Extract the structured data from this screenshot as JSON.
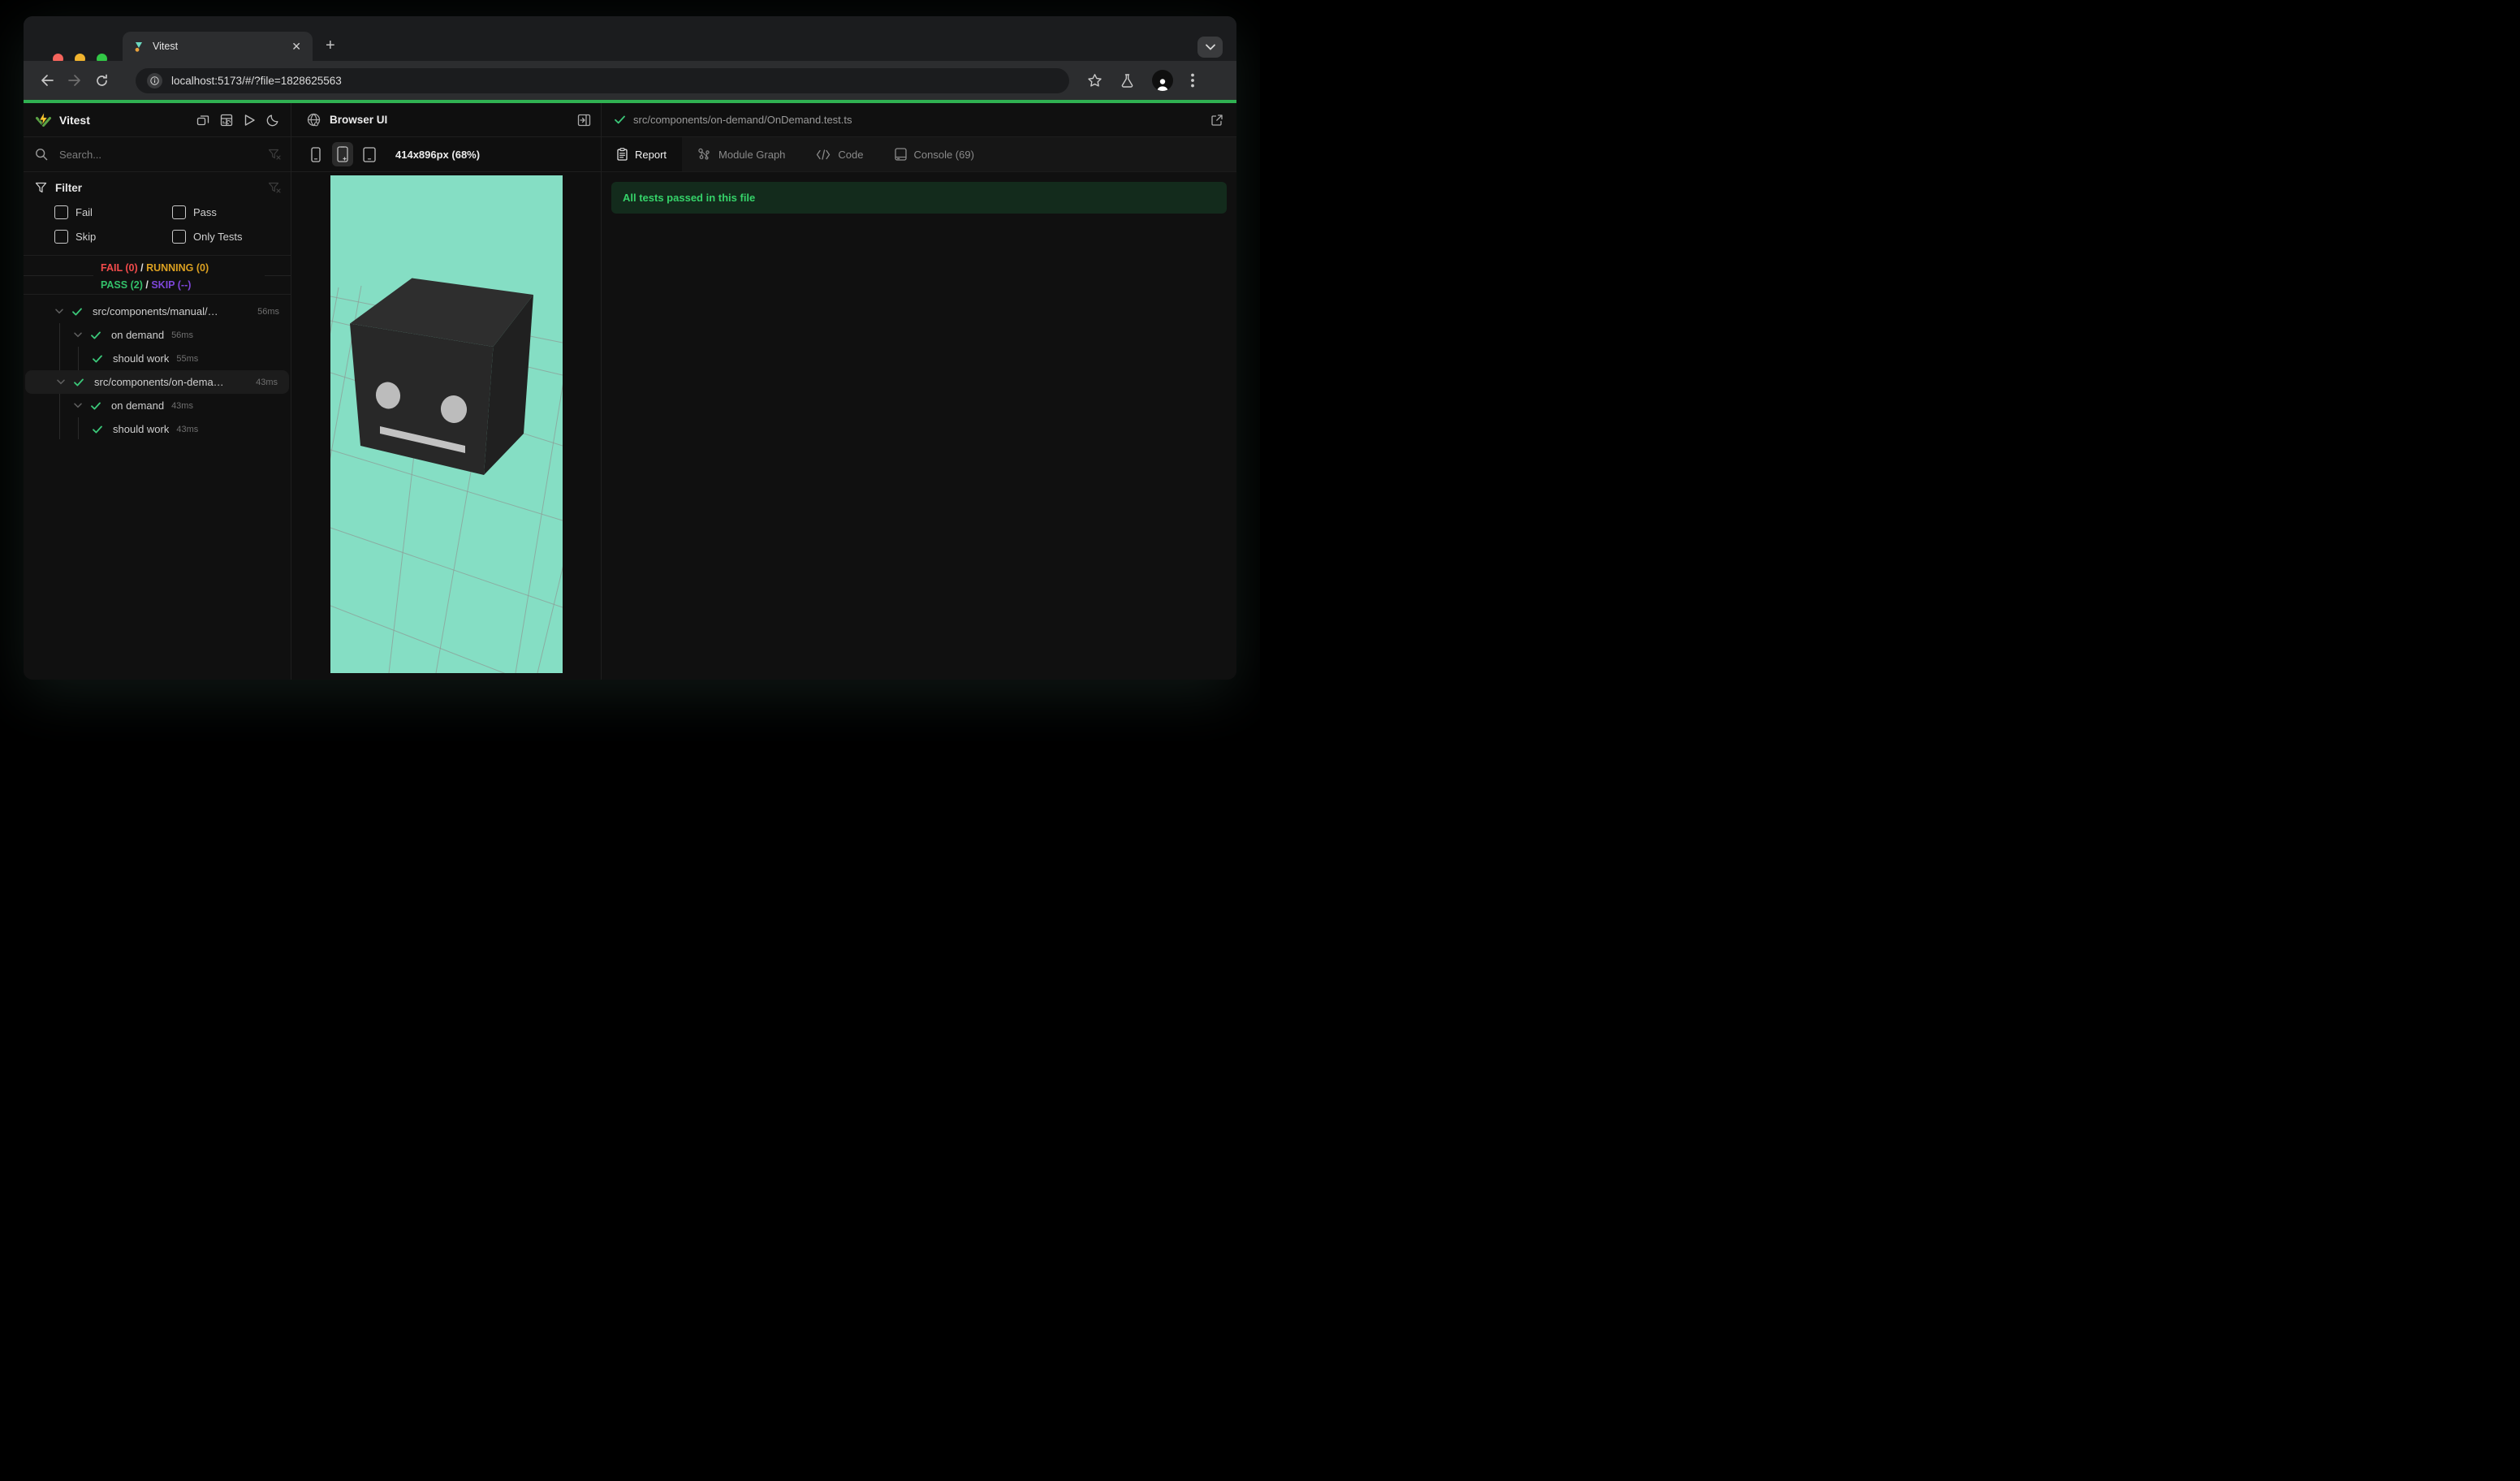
{
  "window": {
    "tab_title": "Vitest",
    "url": "localhost:5173/#/?file=1828625563"
  },
  "sidebar": {
    "title": "Vitest",
    "search_placeholder": "Search...",
    "filter_title": "Filter",
    "filters": {
      "fail": "Fail",
      "pass": "Pass",
      "skip": "Skip",
      "only": "Only Tests"
    },
    "dashboard": {
      "fail": "FAIL (0)",
      "sep1": "/",
      "running": "RUNNING (0)",
      "pass": "PASS (2)",
      "sep2": "/",
      "skip": "SKIP (--)"
    },
    "tree": [
      {
        "name": "src/components/manual/…",
        "duration": "56ms"
      },
      {
        "name": "on demand",
        "duration": "56ms"
      },
      {
        "name": "should work",
        "duration": "55ms"
      },
      {
        "name": "src/components/on-dema…",
        "duration": "43ms"
      },
      {
        "name": "on demand",
        "duration": "43ms"
      },
      {
        "name": "should work",
        "duration": "43ms"
      }
    ]
  },
  "browser_panel": {
    "title": "Browser UI",
    "viewport_size": "414x896px (68%)"
  },
  "report_panel": {
    "file_path": "src/components/on-demand/OnDemand.test.ts",
    "tabs": {
      "report": "Report",
      "module_graph": "Module Graph",
      "code": "Code",
      "console": "Console (69)"
    },
    "banner": "All tests passed in this file"
  },
  "colors": {
    "accent_green": "#30b152",
    "pass_green": "#33c06a",
    "fail_red": "#f24b4b",
    "running_amber": "#dba021",
    "skip_purple": "#7e46d9",
    "viewport_mint": "#85dec4"
  }
}
